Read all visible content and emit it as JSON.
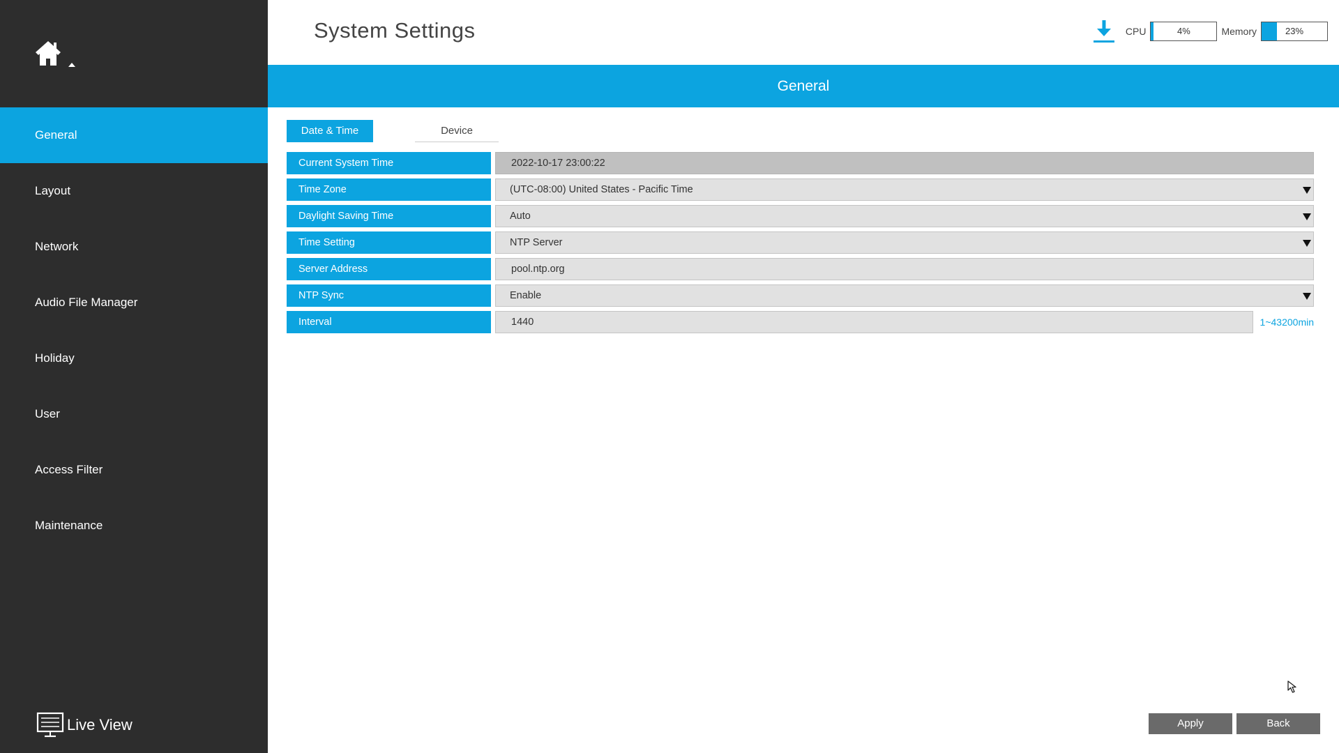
{
  "header": {
    "title": "System Settings",
    "cpu_label": "CPU",
    "cpu_value": "4%",
    "cpu_fraction": 0.04,
    "memory_label": "Memory",
    "memory_value": "23%",
    "memory_fraction": 0.23,
    "download_icon": "download-icon"
  },
  "sidebar": {
    "items": [
      {
        "label": "General",
        "active": true
      },
      {
        "label": "Layout",
        "active": false
      },
      {
        "label": "Network",
        "active": false
      },
      {
        "label": "Audio File Manager",
        "active": false
      },
      {
        "label": "Holiday",
        "active": false
      },
      {
        "label": "User",
        "active": false
      },
      {
        "label": "Access Filter",
        "active": false
      },
      {
        "label": "Maintenance",
        "active": false
      }
    ],
    "live_view_label": "Live View"
  },
  "section": {
    "title": "General"
  },
  "tabs": [
    {
      "label": "Date & Time",
      "active": true
    },
    {
      "label": "Device",
      "active": false
    }
  ],
  "form": {
    "current_time": {
      "label": "Current System Time",
      "value": "2022-10-17 23:00:22"
    },
    "time_zone": {
      "label": "Time Zone",
      "value": "(UTC-08:00) United States - Pacific Time"
    },
    "dst": {
      "label": "Daylight Saving Time",
      "value": "Auto"
    },
    "time_setting": {
      "label": "Time Setting",
      "value": "NTP Server"
    },
    "server_address": {
      "label": "Server Address",
      "value": "pool.ntp.org"
    },
    "ntp_sync": {
      "label": "NTP Sync",
      "value": "Enable"
    },
    "interval": {
      "label": "Interval",
      "value": "1440",
      "hint": "1~43200min"
    }
  },
  "buttons": {
    "apply": "Apply",
    "back": "Back"
  },
  "colors": {
    "accent": "#0ca4e0",
    "sidebar_bg": "#2d2d2d",
    "button_bg": "#6a6a6a"
  }
}
